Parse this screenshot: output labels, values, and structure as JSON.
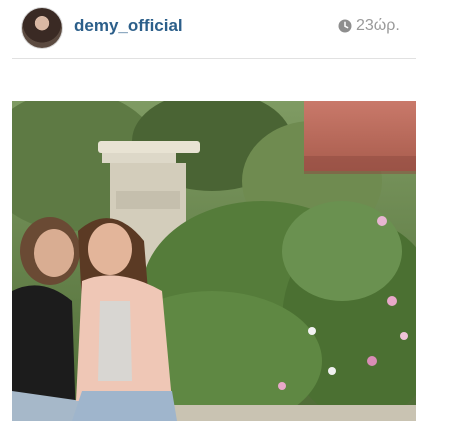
{
  "post": {
    "username": "demy_official",
    "timestamp": "23ώρ.",
    "timestamp_icon": "clock-icon",
    "avatar_icon": "profile-avatar"
  },
  "photo": {
    "description_icon": "photo"
  }
}
